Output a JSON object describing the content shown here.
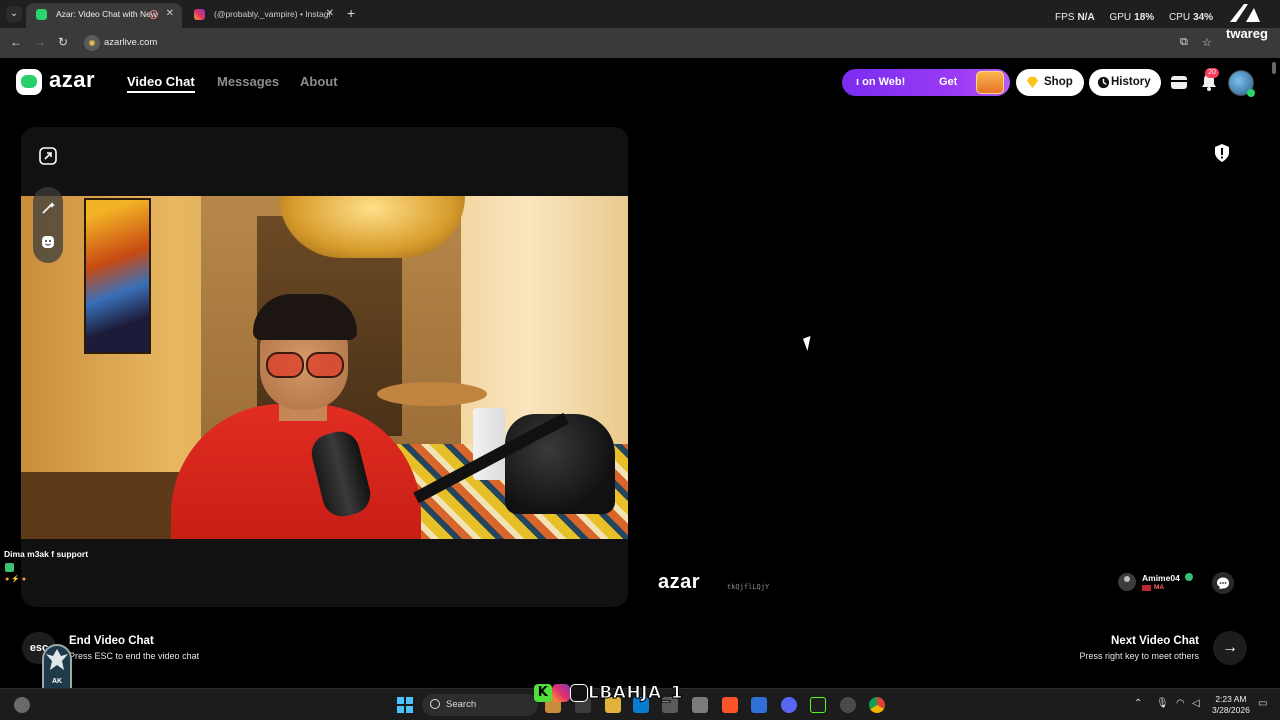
{
  "browser": {
    "tabs": [
      {
        "title": "Azar: Video Chat with New",
        "active": true,
        "favicon_color": "#2bd46c"
      },
      {
        "title": "(@probably._vampire) • Instagr",
        "active": false,
        "favicon_color": "#e1306c"
      }
    ],
    "url": "azarlive.com"
  },
  "overlay_stats": {
    "fps_label": "FPS",
    "fps_value": "N/A",
    "gpu_label": "GPU",
    "gpu_value": "18%",
    "cpu_label": "CPU",
    "cpu_value": "34%"
  },
  "watermark_logo": {
    "name": "twareg"
  },
  "azar": {
    "brand": "azar",
    "nav": [
      {
        "label": "Video Chat",
        "active": true
      },
      {
        "label": "Messages",
        "active": false
      },
      {
        "label": "About",
        "active": false
      }
    ],
    "promo": {
      "text_left": "ı on Web!",
      "text_right": "Get"
    },
    "shop_label": "Shop",
    "history_label": "History",
    "notification_count": "20"
  },
  "local_stream": {
    "viewer_name": "Dima m3ak f support"
  },
  "remote_stream": {
    "watermark": "azar",
    "watermark_id": "tkQjflLQjY",
    "partner_name": "Amime04",
    "partner_country": "MA"
  },
  "controls": {
    "end_key": "esc",
    "end_title": "End Video Chat",
    "end_sub": "Press ESC to end the video chat",
    "next_title": "Next Video Chat",
    "next_sub": "Press right key to meet others"
  },
  "ak_badge": "AK",
  "streamer_tag": "LBAHJA_1",
  "taskbar": {
    "search_label": "Search",
    "time": "2:23 AM",
    "date": "3/28/2026"
  },
  "colors": {
    "accent_green": "#2bd46c",
    "promo_purple": "#8b34f3",
    "card_bg": "#111111"
  }
}
